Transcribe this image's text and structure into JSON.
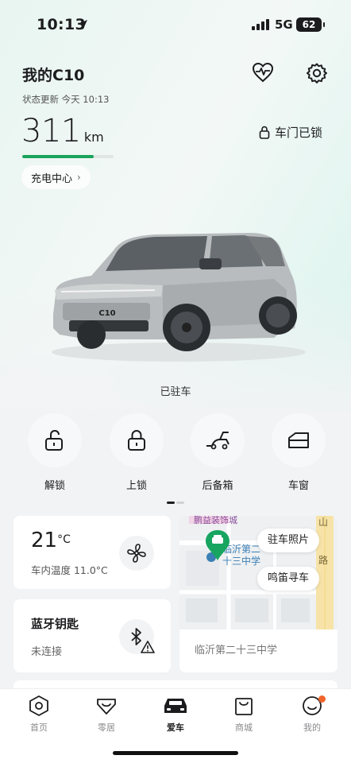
{
  "status_bar": {
    "time": "10:13",
    "network": "5G",
    "battery": "62"
  },
  "header": {
    "car_name": "我的C10",
    "update_text": "状态更新 今天 10:13"
  },
  "range": {
    "value": "311",
    "unit": "km",
    "level_fraction": 0.78
  },
  "lock_status": "车门已锁",
  "charge_center": "充电中心",
  "car": {
    "plate_text": "C10",
    "park_status": "已驻车"
  },
  "actions": [
    {
      "label": "解锁",
      "icon": "unlock-icon"
    },
    {
      "label": "上锁",
      "icon": "lock-icon"
    },
    {
      "label": "后备箱",
      "icon": "trunk-icon"
    },
    {
      "label": "车窗",
      "icon": "window-icon"
    }
  ],
  "climate": {
    "temp": "21",
    "unit": "°C",
    "sub": "车内温度 11.0°C"
  },
  "bluetooth": {
    "title": "蓝牙钥匙",
    "status": "未连接"
  },
  "map": {
    "photo_btn": "驻车照片",
    "horn_btn": "鸣笛寻车",
    "location": "临沂第二十三中学",
    "map_label_1": "临沂第二",
    "map_label_2": "十三中学",
    "map_label_top": "鹏益装饰城",
    "road_chars": [
      "山",
      "路"
    ]
  },
  "tabs": [
    {
      "label": "首页",
      "icon": "hexagon-home-icon",
      "active": false
    },
    {
      "label": "零居",
      "icon": "heart-shield-icon",
      "active": false
    },
    {
      "label": "爱车",
      "icon": "car-icon",
      "active": true
    },
    {
      "label": "商城",
      "icon": "shopping-bag-icon",
      "active": false
    },
    {
      "label": "我的",
      "icon": "profile-icon",
      "active": false
    }
  ],
  "colors": {
    "accent_green": "#1aa35b",
    "badge_orange": "#f0642a",
    "map_pin_green": "#17a560"
  }
}
